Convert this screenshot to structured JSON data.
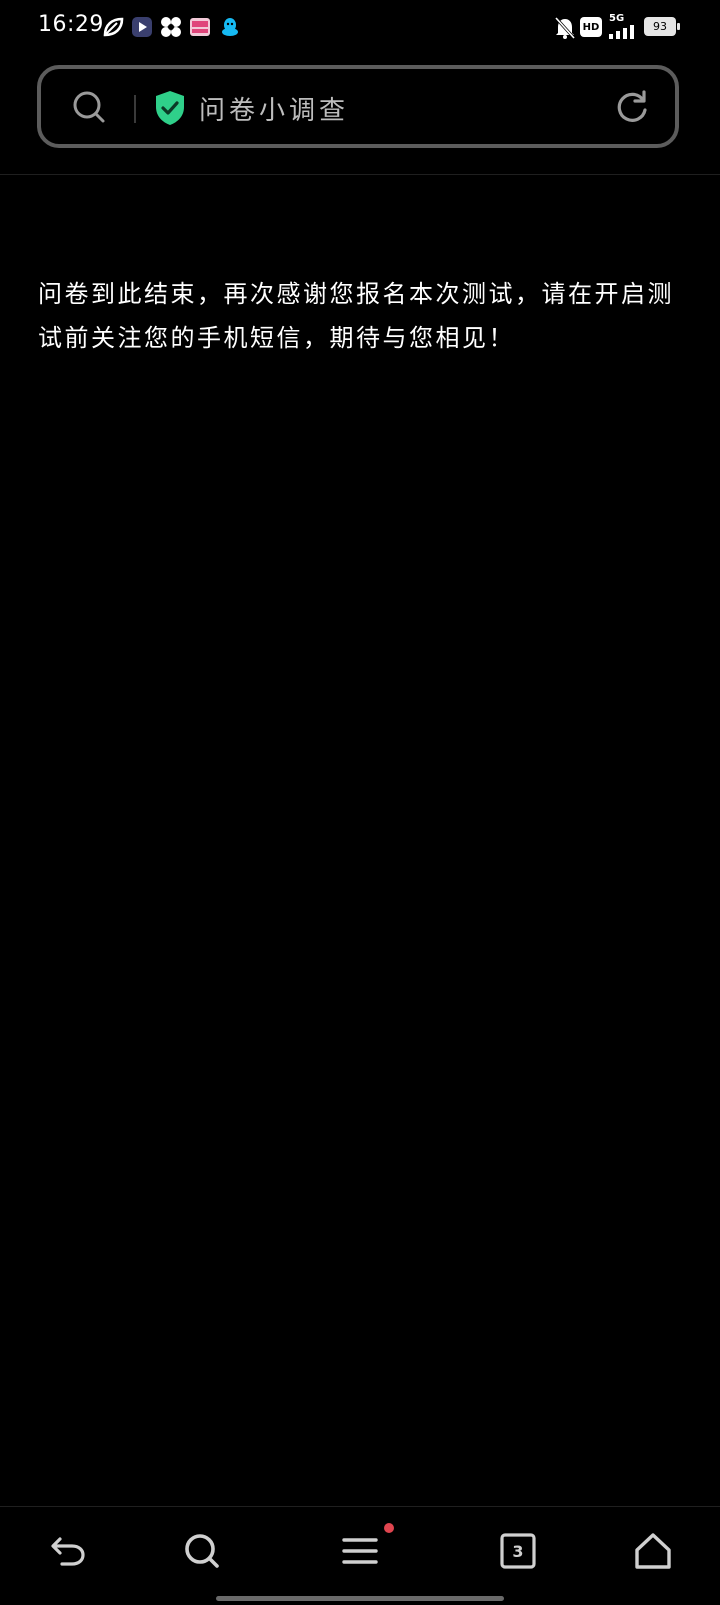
{
  "status_bar": {
    "time": "16:29",
    "network": "5G",
    "hd_label": "HD",
    "battery": "93",
    "icons": [
      "leaf-app-icon",
      "video-app-icon",
      "pinwheel-app-icon",
      "bilibili-app-icon",
      "qq-app-icon",
      "mute-bell-icon",
      "hd-icon",
      "signal-icon",
      "battery-icon"
    ]
  },
  "address_bar": {
    "title": "问卷小调查",
    "icons": [
      "search-icon",
      "shield-check-icon",
      "refresh-icon"
    ],
    "shield_color": "#2fd08a"
  },
  "content": {
    "message": "问卷到此结束，再次感谢您报名本次测试，请在开启测试前关注您的手机短信，期待与您相见！"
  },
  "bottom_nav": {
    "tabs_count": "3",
    "icons": [
      "back-icon",
      "search-icon",
      "menu-icon",
      "tabs-icon",
      "home-icon"
    ],
    "notification_color": "#e0454f"
  }
}
